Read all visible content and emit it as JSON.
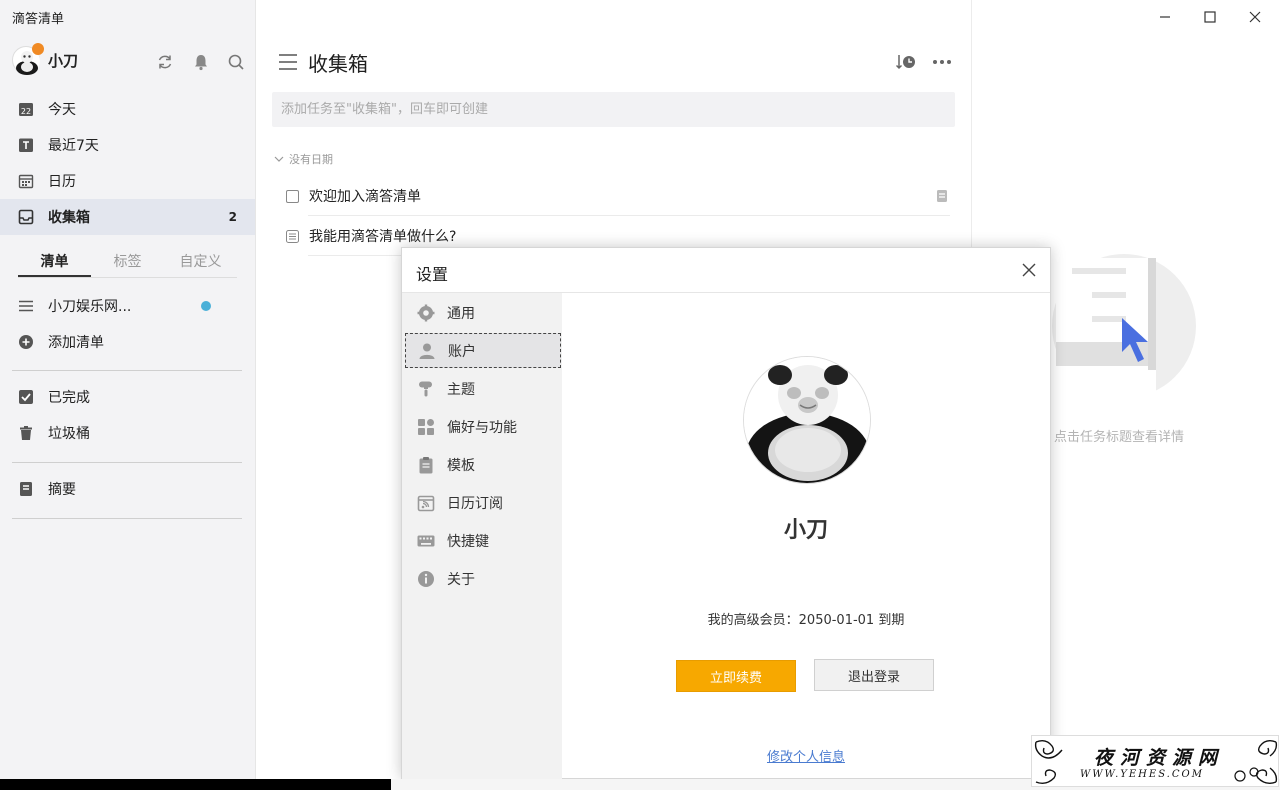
{
  "app": {
    "title": "滴答清单"
  },
  "profile": {
    "name": "小刀"
  },
  "nav": {
    "today": "今天",
    "next7": "最近7天",
    "calendar": "日历",
    "inbox": "收集箱",
    "inbox_count": "2",
    "today_day": "22"
  },
  "sidebar_tabs": [
    "清单",
    "标签",
    "自定义"
  ],
  "lists": {
    "item1": "小刀娱乐网...",
    "add_list": "添加清单",
    "completed": "已完成",
    "trash": "垃圾桶",
    "summary": "摘要"
  },
  "main": {
    "title": "收集箱",
    "input_placeholder": "添加任务至\"收集箱\"，回车即可创建",
    "section_label": "没有日期",
    "tasks": [
      {
        "title": "欢迎加入滴答清单"
      },
      {
        "title": "我能用滴答清单做什么?"
      }
    ]
  },
  "detail": {
    "hint": "点击任务标题查看详情"
  },
  "dialog": {
    "title": "设置",
    "menu": [
      "通用",
      "账户",
      "主题",
      "偏好与功能",
      "模板",
      "日历订阅",
      "快捷键",
      "关于"
    ],
    "active_menu": "账户",
    "profile_name": "小刀",
    "membership": "我的高级会员：2050-01-01 到期",
    "renew_button": "立即续费",
    "logout_button": "退出登录",
    "edit_profile_link": "修改个人信息"
  },
  "watermark": {
    "title": "夜河资源网",
    "url": "WWW.YEHES.COM"
  },
  "colors": {
    "accent": "#f7a800",
    "link": "#4a7bd0",
    "list_dot": "#4ab0d8",
    "active_nav": "#e3e6ee"
  }
}
